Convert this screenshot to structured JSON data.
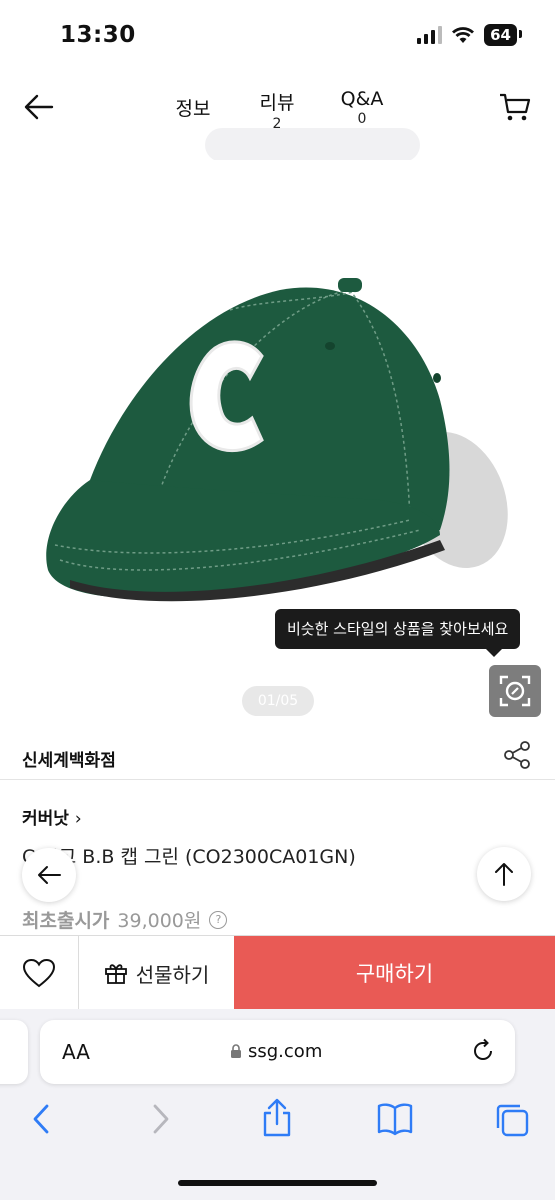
{
  "status_bar": {
    "time": "13:30",
    "battery": "64"
  },
  "header": {
    "tabs": [
      {
        "label": "정보",
        "count": ""
      },
      {
        "label": "리뷰",
        "count": "2"
      },
      {
        "label": "Q&A",
        "count": "0"
      }
    ]
  },
  "gallery": {
    "tooltip": "비슷한 스타일의 상품을 찾아보세요",
    "pager": "01/05",
    "cap_colors": {
      "cap": "#1d5a3f",
      "logo": "#ffffff"
    }
  },
  "store": {
    "name": "신세계백화점"
  },
  "product": {
    "brand": "커버낫",
    "brand_chevron": "›",
    "name": "C 로고 B.B 캡 그린 (CO2300CA01GN)",
    "price_label": "최초출시가",
    "price": "39,000원",
    "help_mark": "?"
  },
  "purchase_bar": {
    "gift_label": "선물하기",
    "buy_label": "구매하기",
    "buy_color": "#e95a55"
  },
  "browser": {
    "aa_label": "AA",
    "url": "ssg.com",
    "accent": "#2f7cf6"
  }
}
